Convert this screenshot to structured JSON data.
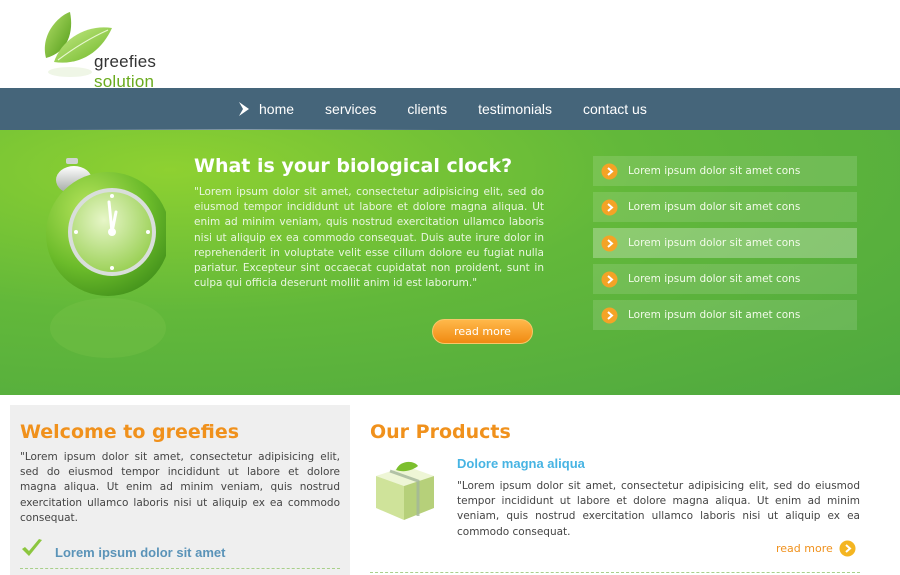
{
  "logo": {
    "text_main": "greefies ",
    "text_accent": "solution"
  },
  "nav": {
    "items": [
      "home",
      "services",
      "clients",
      "testimonials",
      "contact us"
    ]
  },
  "hero": {
    "title": "What is your biological clock?",
    "text": "\"Lorem ipsum dolor sit amet, consectetur adipisicing elit, sed do eiusmod tempor incididunt ut labore et dolore magna aliqua. Ut enim ad minim veniam, quis nostrud exercitation ullamco laboris nisi ut aliquip ex ea commodo consequat. Duis aute irure dolor in reprehenderit in voluptate velit esse cillum dolore eu fugiat nulla pariatur. Excepteur sint occaecat cupidatat non proident, sunt in culpa qui officia deserunt mollit anim id est laborum.\"",
    "button": "read more",
    "list": [
      "Lorem ipsum dolor sit amet cons",
      "Lorem ipsum dolor sit amet cons",
      "Lorem ipsum dolor sit amet cons",
      "Lorem ipsum dolor sit amet cons",
      "Lorem ipsum dolor sit amet cons"
    ]
  },
  "welcome": {
    "title": "Welcome to greefies",
    "text": "\"Lorem ipsum dolor sit amet, consectetur adipisicing elit, sed do eiusmod tempor incididunt ut labore et dolore magna aliqua. Ut enim ad minim veniam, quis nostrud exercitation ullamco laboris nisi ut aliquip ex ea commodo consequat.",
    "link": "Lorem ipsum dolor sit amet"
  },
  "products": {
    "title": "Our Products",
    "item_name": "Dolore magna aliqua",
    "item_text": "\"Lorem ipsum dolor sit amet, consectetur adipisicing elit, sed do eiusmod tempor incididunt ut labore et dolore magna aliqua. Ut enim ad minim veniam, quis nostrud exercitation ullamco laboris nisi ut aliquip ex ea commodo consequat.",
    "read_more": "read more"
  },
  "colors": {
    "nav": "#45657a",
    "hero": "#4ea840",
    "accent": "#f0911c",
    "link": "#47b4e3"
  },
  "icons": [
    "leaf-logo-icon",
    "arrow-right-icon",
    "alarm-clock-icon",
    "bullet-arrow-icon",
    "check-icon",
    "product-box-icon"
  ]
}
